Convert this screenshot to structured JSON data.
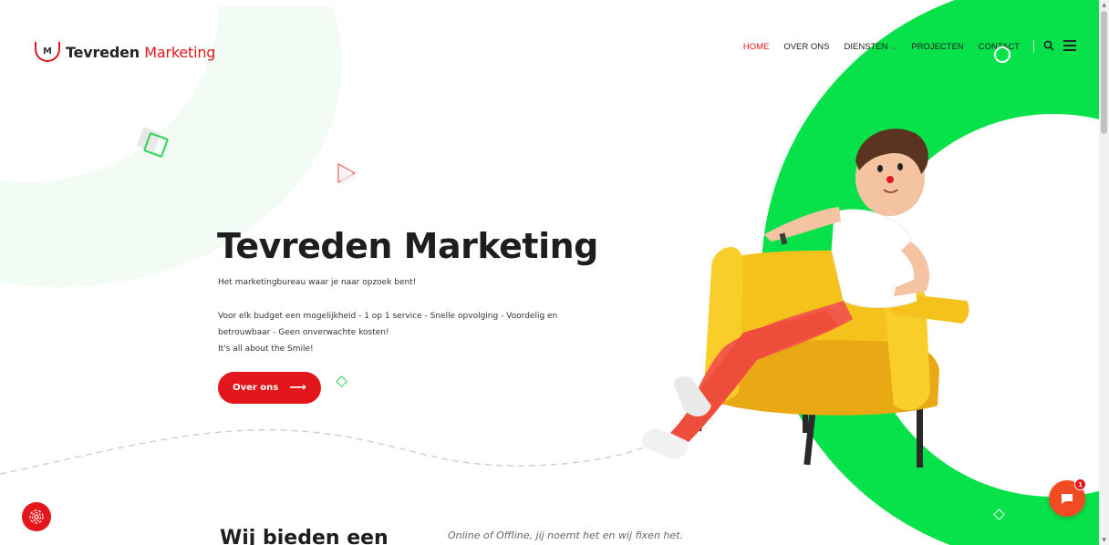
{
  "brand": {
    "logo_mark": "M",
    "name_bold": "Tevreden",
    "name_light": "Marketing",
    "accent_color": "#e3161b",
    "green_color": "#07e24b"
  },
  "nav": {
    "items": [
      {
        "label": "HOME",
        "active": true
      },
      {
        "label": "OVER ONS",
        "active": false
      },
      {
        "label": "DIENSTEN",
        "active": false,
        "has_dropdown": true
      },
      {
        "label": "PROJECTEN",
        "active": false
      },
      {
        "label": "CONTACT",
        "active": false
      }
    ],
    "search_icon": "search-icon",
    "menu_icon": "hamburger-menu-icon"
  },
  "hero": {
    "title": "Tevreden Marketing",
    "subtitle": "Het marketingbureau waar je naar opzoek bent!",
    "desc_line1": "Voor elk budget een mogelijkheid - 1 op 1 service - Snelle opvolging - Voordelig en betrouwbaar - Geen onverwachte kosten!",
    "desc_line2": "It's all about the Smile!",
    "button_label": "Over ons",
    "button_arrow": "⟶"
  },
  "section": {
    "title": "Wij bieden een",
    "tagline": "Online of Offline, jij noemt het en wij fixen het."
  },
  "chat": {
    "unread_count": "1"
  }
}
